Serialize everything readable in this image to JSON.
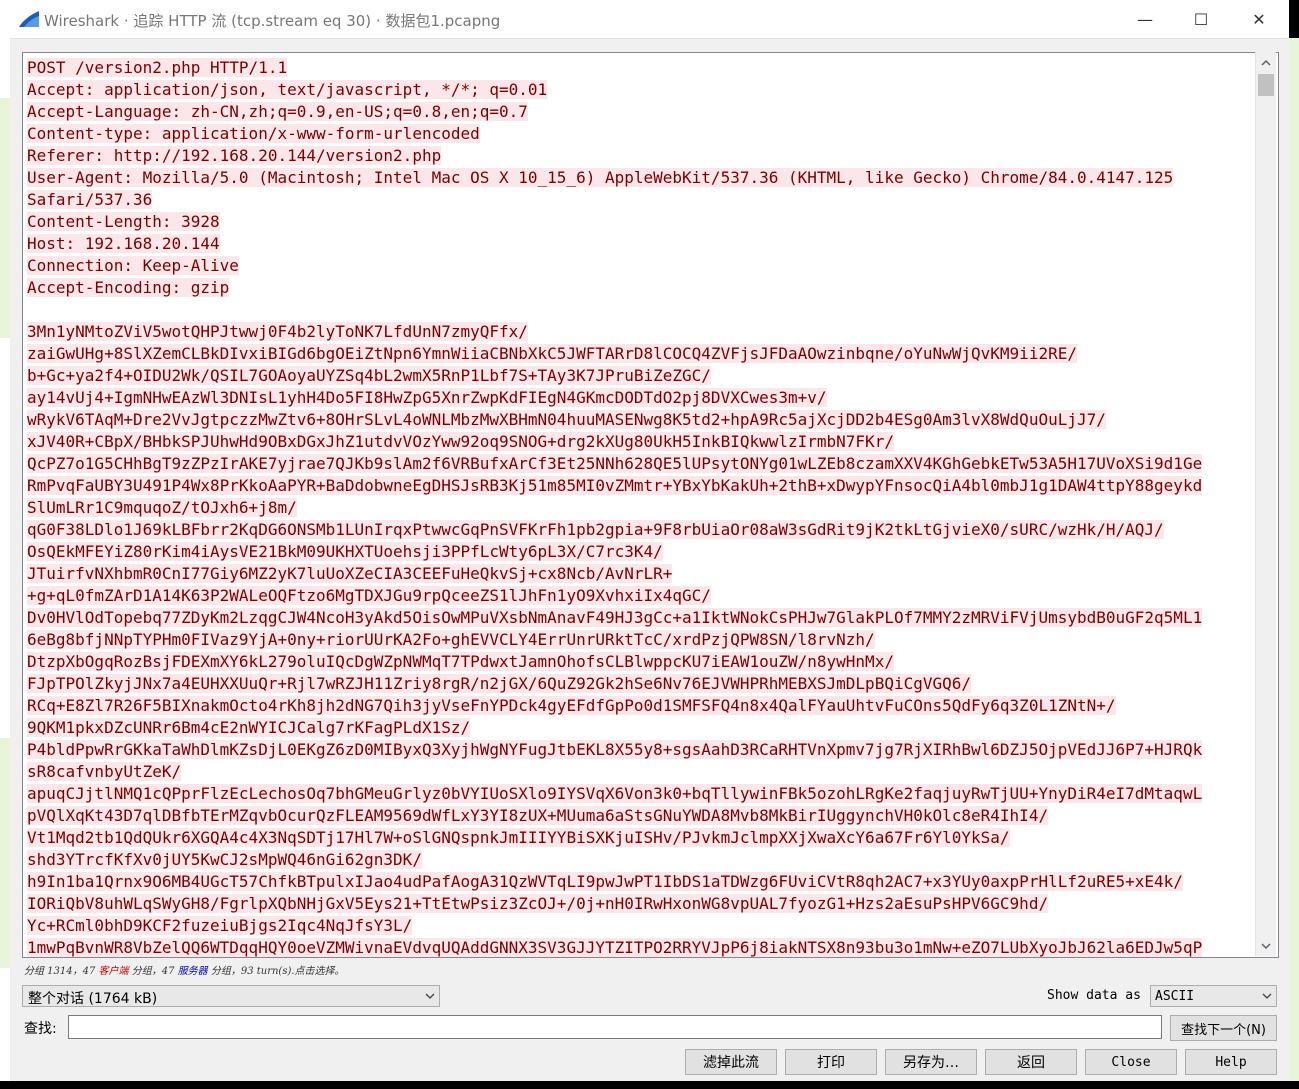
{
  "window": {
    "title": "Wireshark · 追踪 HTTP 流 (tcp.stream eq 30) · 数据包1.pcapng",
    "controls": {
      "minimize": "—",
      "maximize": "☐",
      "close": "✕"
    }
  },
  "stream_lines": [
    "POST /version2.php HTTP/1.1",
    "Accept: application/json, text/javascript, */*; q=0.01",
    "Accept-Language: zh-CN,zh;q=0.9,en-US;q=0.8,en;q=0.7",
    "Content-type: application/x-www-form-urlencoded",
    "Referer: http://192.168.20.144/version2.php",
    "User-Agent: Mozilla/5.0 (Macintosh; Intel Mac OS X 10_15_6) AppleWebKit/537.36 (KHTML, like Gecko) Chrome/84.0.4147.125",
    "Safari/537.36",
    "Content-Length: 3928",
    "Host: 192.168.20.144",
    "Connection: Keep-Alive",
    "Accept-Encoding: gzip",
    "",
    "3Mn1yNMtoZViV5wotQHPJtwwj0F4b2lyToNK7LfdUnN7zmyQFfx/",
    "zaiGwUHg+8SlXZemCLBkDIvxiBIGd6bgOEiZtNpn6YmnWiiaCBNbXkC5JWFTARrD8lCOCQ4ZVFjsJFDaAOwzinbqne/oYuNwWjQvKM9ii2RE/",
    "b+Gc+ya2f4+OIDU2Wk/QSIL7GOAoyaUYZSq4bL2wmX5RnP1Lbf7S+TAy3K7JPruBiZeZGC/",
    "ay14vUj4+IgmNHwEAzWl3DNIsL1yhH4Do5FI8HwZpG5XnrZwpKdFIEgN4GKmcDODTdO2pj8DVXCwes3m+v/",
    "wRykV6TAqM+Dre2VvJgtpczzMwZtv6+8OHrSLvL4oWNLMbzMwXBHmN04huuMASENwg8K5td2+hpA9Rc5ajXcjDD2b4ESg0Am3lvX8WdQuOuLjJ7/",
    "xJV40R+CBpX/BHbkSPJUhwHd9OBxDGxJhZ1utdvVOzYww92oq9SNOG+drg2kXUg80UkH5InkBIQkwwlzIrmbN7FKr/",
    "QcPZ7o1G5CHhBgT9zZPzIrAKE7yjrae7QJKb9slAm2f6VRBufxArCf3Et25NNh628QE5lUPsytONYg01wLZEb8czamXXV4KGhGebkETw53A5H17UVoXSi9d1Ge",
    "RmPvqFaUBY3U491P4Wx8PrKkoAaPYR+BaDdobwneEgDHSJsRB3Kj51m85MI0vZMmtr+YBxYbKakUh+2thB+xDwypYFnsocQiA4bl0mbJ1g1DAW4ttpY88geykd",
    "SlUmLRr1C9mquqoZ/tOJxh6+j8m/",
    "qG0F38LDlo1J69kLBFbrr2KqDG6ONSMb1LUnIrqxPtwwcGqPnSVFKrFh1pb2gpia+9F8rbUiaOr08aW3sGdRit9jK2tkLtGjvieX0/sURC/wzHk/H/AQJ/",
    "OsQEkMFEYiZ80rKim4iAysVE21BkM09UKHXTUoehsji3PPfLcWty6pL3X/C7rc3K4/",
    "JTuirfvNXhbmR0CnI77Giy6MZ2yK7luUoXZeCIA3CEEFuHeQkvSj+cx8Ncb/AvNrLR+",
    "+g+qL0fmZArD1A14K63P2WALeOQFtzo6MgTDXJGu9rpQceeZS1lJhFn1yO9XvhxiIx4qGC/",
    "Dv0HVlOdTopebq77ZDyKm2LzqgCJW4NcoH3yAkd5OisOwMPuVXsbNmAnavF49HJ3gCc+a1IktWNokCsPHJw7GlakPLOf7MMY2zMRViFVjUmsybdB0uGF2q5ML1",
    "6eBg8bfjNNpTYPHm0FIVaz9YjA+0ny+riorUUrKA2Fo+ghEVVCLY4ErrUnrURktTcC/xrdPzjQPW8SN/l8rvNzh/",
    "DtzpXbOgqRozBsjFDEXmXY6kL279oluIQcDgWZpNWMqT7TPdwxtJamnOhofsCLBlwppcKU7iEAW1ouZW/n8ywHnMx/",
    "FJpTPOlZkyjJNx7a4EUHXXUuQr+Rjl7wRZJH11Zriy8rgR/n2jGX/6QuZ92Gk2hSe6Nv76EJVWHPRhMEBXSJmDLpBQiCgVGQ6/",
    "RCq+E8Zl7R26F5BIXnakmOcto4rKh8jh2dNG7Qih3jyVseFnYPDck4gyEFdfGpPo0d1SMFSFQ4n8x4QalFYauUhtvFuCOns5QdFy6q3Z0L1ZNtN+/",
    "9QKM1pkxDZcUNRr6Bm4cE2nWYICJCalg7rKFagPLdX1Sz/",
    "P4bldPpwRrGKkaTaWhDlmKZsDjL0EKgZ6zD0MIByxQ3XyjhWgNYFugJtbEKL8X55y8+sgsAahD3RCaRHTVnXpmv7jg7RjXIRhBwl6DZJ5OjpVEdJJ6P7+HJRQk",
    "sR8cafvnbyUtZeK/",
    "apuqCJjtlNMQ1cQPprFlzEcLechosOq7bhGMeuGrlyz0bVYIUoSXlo9IYSVqX6Von3k0+bqTllywinFBk5ozohLRgKe2faqjuyRwTjUU+YnyDiR4eI7dMtaqwL",
    "pVQlXqKt43D7qlDBfbTErMZqvbOcurQzFLEAM9569dWfLxY3YI8zUX+MUuma6aStsGNuYWDA8Mvb8MkBirIUggynchVH0kOlc8eR4IhI4/",
    "Vt1Mqd2tb1QdQUkr6XGQA4c4X3NqSDTj17Hl7W+oSlGNQspnkJmIIIYYBiSXKjuISHv/PJvkmJclmpXXjXwaXcY6a67Fr6Yl0YkSa/",
    "shd3YTrcfKfXv0jUY5KwCJ2sMpWQ46nGi62gn3DK/",
    "h9In1ba1Qrnx9O6MB4UGcT57ChfkBTpulxIJao4udPafAogA31QzWVTqLI9pwJwPT1IbDS1aTDWzg6FUviCVtR8qh2AC7+x3YUy0axpPrHlLf2uRE5+xE4k/",
    "IORiQbV8uhWLqSWyGH8/FgrlpXQbNHjGxV5Eys21+TtEtwPsiz3ZcOJ+/0j+nH0IRwHxonWG8vpUAL7fyozG1+Hzs2aEsuPsHPV6GC9hd/",
    "Yc+RCml0bhD9KCF2fuzeiuBjgs2Iqc4NqJfsY3L/",
    "1mwPqBvnWR8VbZelQQ6WTDqqHQY0oeVZMWivnaEVdvqUQAddGNNX3SV3GJJYTZITPO2RRYVJpP6j8iakNTSX8n93bu3o1mNw+eZO7LUbXyoJbJ62la6EDJw5qP"
  ],
  "summary": {
    "prefix": "分组 1314，47",
    "client": "客户端",
    "middle": "分组，47",
    "server": "服务器",
    "suffix": "分组，93 turn(s).点击选择。"
  },
  "conversation": {
    "selected": "整个对话 (1764 kB)"
  },
  "show_data": {
    "label": "Show data as",
    "selected": "ASCII"
  },
  "find": {
    "label": "查找:",
    "value": "",
    "next_button": "查找下一个(N)"
  },
  "buttons": {
    "filter": "滤掉此流",
    "print": "打印",
    "save_as": "另存为…",
    "back": "返回",
    "close": "Close",
    "help": "Help"
  },
  "colors": {
    "client_text": "#7a0000",
    "client_bg": "#fbe6ea",
    "accent_blue": "#1a5fb4"
  },
  "icons": {
    "app": "wireshark-fin-icon",
    "scroll_up": "chevron-up-icon",
    "scroll_down": "chevron-down-icon",
    "dropdown": "chevron-down-icon"
  }
}
